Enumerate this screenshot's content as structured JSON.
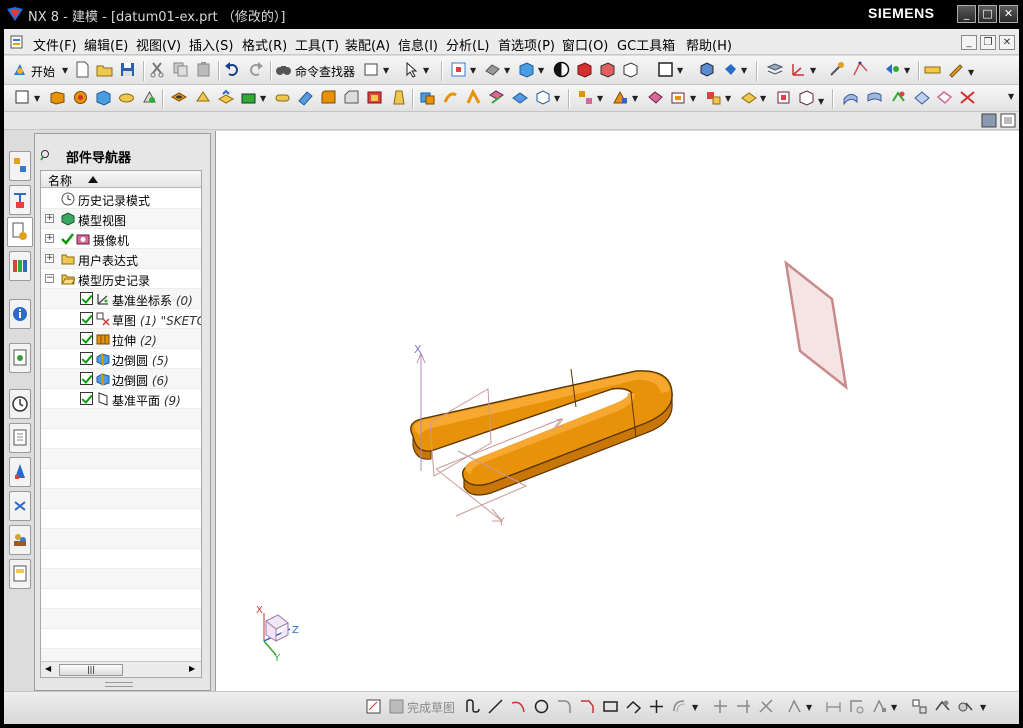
{
  "window": {
    "title": "NX 8 - 建模 - [datum01-ex.prt （修改的）]",
    "brand": "SIEMENS",
    "controls": [
      "_",
      "□",
      "✕"
    ]
  },
  "menubar": {
    "items": [
      "文件(F)",
      "编辑(E)",
      "视图(V)",
      "插入(S)",
      "格式(R)",
      "工具(T)",
      "装配(A)",
      "信息(I)",
      "分析(L)",
      "首选项(P)",
      "窗口(O)",
      "GC工具箱",
      "帮助(H)"
    ]
  },
  "toolbar": {
    "start_label": "开始",
    "command_finder_label": "命令查找器"
  },
  "navigator": {
    "title": "部件导航器",
    "column_header": "名称",
    "rows": [
      {
        "label": "历史记录模式",
        "num": "",
        "icon": "clock-icon"
      },
      {
        "label": "模型视图",
        "num": "",
        "icon": "model-views-icon"
      },
      {
        "label": "摄像机",
        "num": "",
        "icon": "camera-icon"
      },
      {
        "label": "用户表达式",
        "num": "",
        "icon": "folder-icon"
      },
      {
        "label": "模型历史记录",
        "num": "",
        "icon": "folder-open-icon"
      },
      {
        "label": "基准坐标系",
        "num": "(0)",
        "icon": "datum-csys-icon"
      },
      {
        "label": "草图",
        "num": "(1) \"SKETC",
        "icon": "sketch-icon"
      },
      {
        "label": "拉伸",
        "num": "(2)",
        "icon": "extrude-icon"
      },
      {
        "label": "边倒圆",
        "num": "(5)",
        "icon": "edge-blend-icon"
      },
      {
        "label": "边倒圆",
        "num": "(6)",
        "icon": "edge-blend-icon"
      },
      {
        "label": "基准平面",
        "num": "(9)",
        "icon": "datum-plane-icon"
      }
    ]
  },
  "viewport": {
    "axis_labels": {
      "x": "X",
      "y": "Y",
      "z": "Z"
    },
    "triad_labels": {
      "x": "X",
      "y": "Y",
      "z": "Z"
    }
  },
  "sketch_bar": {
    "finish_label": "完成草图"
  },
  "colors": {
    "part_orange": "#e8920a",
    "datum_plane": "#c88a8a",
    "axis_purple": "#8a78c8"
  }
}
